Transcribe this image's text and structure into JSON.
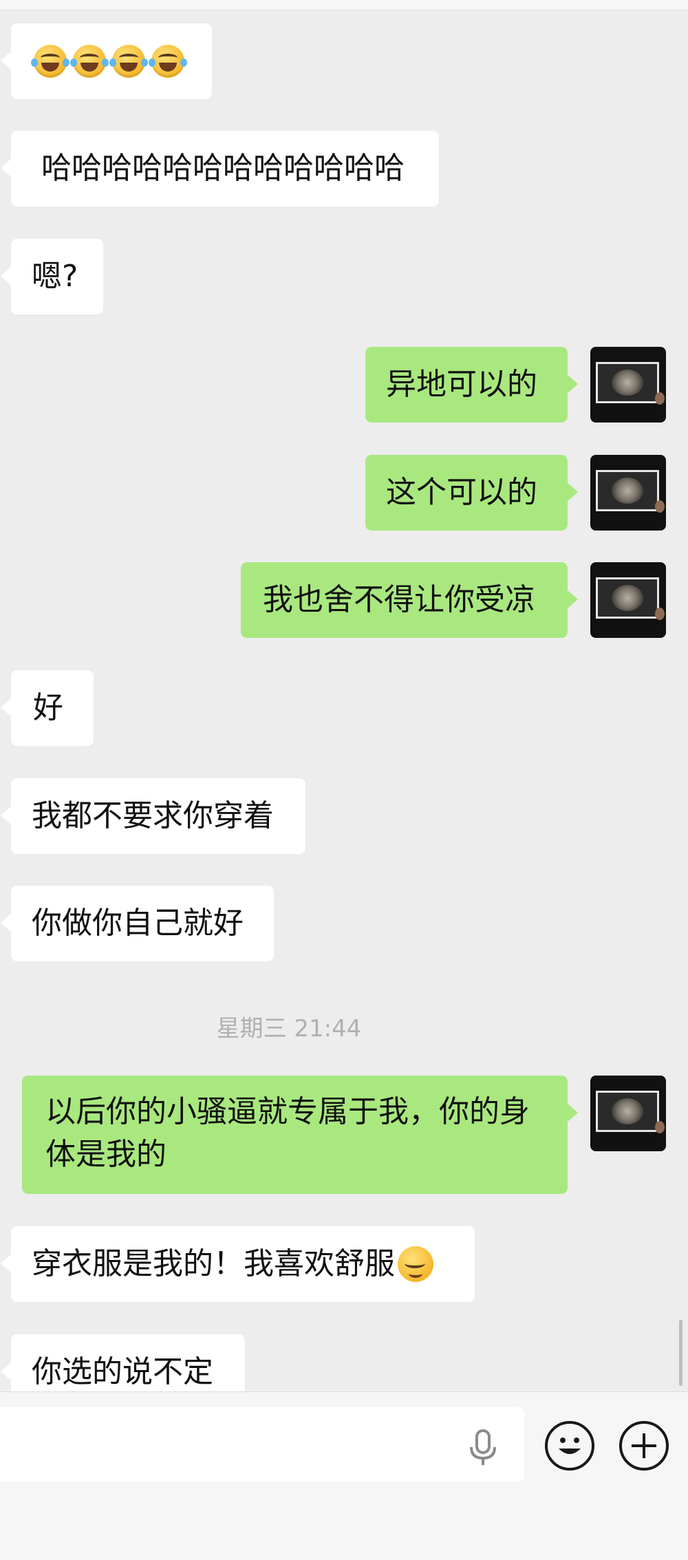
{
  "messages": [
    {
      "side": "in",
      "kind": "emoji",
      "emoji": [
        "face-with-tears-of-joy",
        "face-with-tears-of-joy",
        "face-with-tears-of-joy",
        "face-with-tears-of-joy"
      ]
    },
    {
      "side": "in",
      "text": "哈哈哈哈哈哈哈哈哈哈哈哈"
    },
    {
      "side": "in",
      "text": "嗯?"
    },
    {
      "side": "out",
      "text": "异地可以的"
    },
    {
      "side": "out",
      "text": "这个可以的"
    },
    {
      "side": "out",
      "text": "我也舍不得让你受凉"
    },
    {
      "side": "in",
      "text": "好"
    },
    {
      "side": "in",
      "text": "我都不要求你穿着"
    },
    {
      "side": "in",
      "text": "你做你自己就好"
    },
    {
      "side": "out",
      "text": "以后你的小骚逼就专属于我，你的身体是我的"
    },
    {
      "side": "in",
      "text": "穿衣服是我的！我喜欢舒服",
      "emoji": "relieved-face"
    },
    {
      "side": "in",
      "text": "你选的说不定"
    }
  ],
  "timestamp": "星期三 21:44",
  "input_bar": {
    "input_value": "",
    "icons": [
      "microphone-icon",
      "emoji-icon",
      "plus-icon"
    ]
  },
  "colors": {
    "background": "#ededed",
    "incoming_bubble": "#ffffff",
    "outgoing_bubble": "#a9e87f",
    "timestamp": "#b0b0b0"
  }
}
